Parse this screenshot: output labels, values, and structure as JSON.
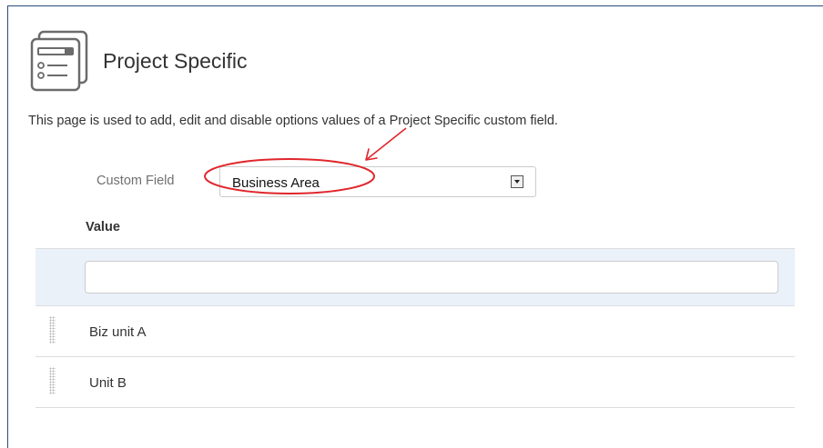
{
  "page": {
    "title": "Project Specific",
    "description": "This page is used to add, edit and disable options values of a Project Specific custom field.",
    "icon": "custom-field-options-icon"
  },
  "custom_field": {
    "label": "Custom Field",
    "selected": "Business Area"
  },
  "table": {
    "header": "Value",
    "new_value": "",
    "rows": [
      {
        "label": "Biz unit A"
      },
      {
        "label": "Unit B"
      }
    ]
  },
  "colors": {
    "annotation": "#e0262c",
    "add_row_background": "#ebf1f9",
    "frame_border": "#2a4b7c"
  }
}
